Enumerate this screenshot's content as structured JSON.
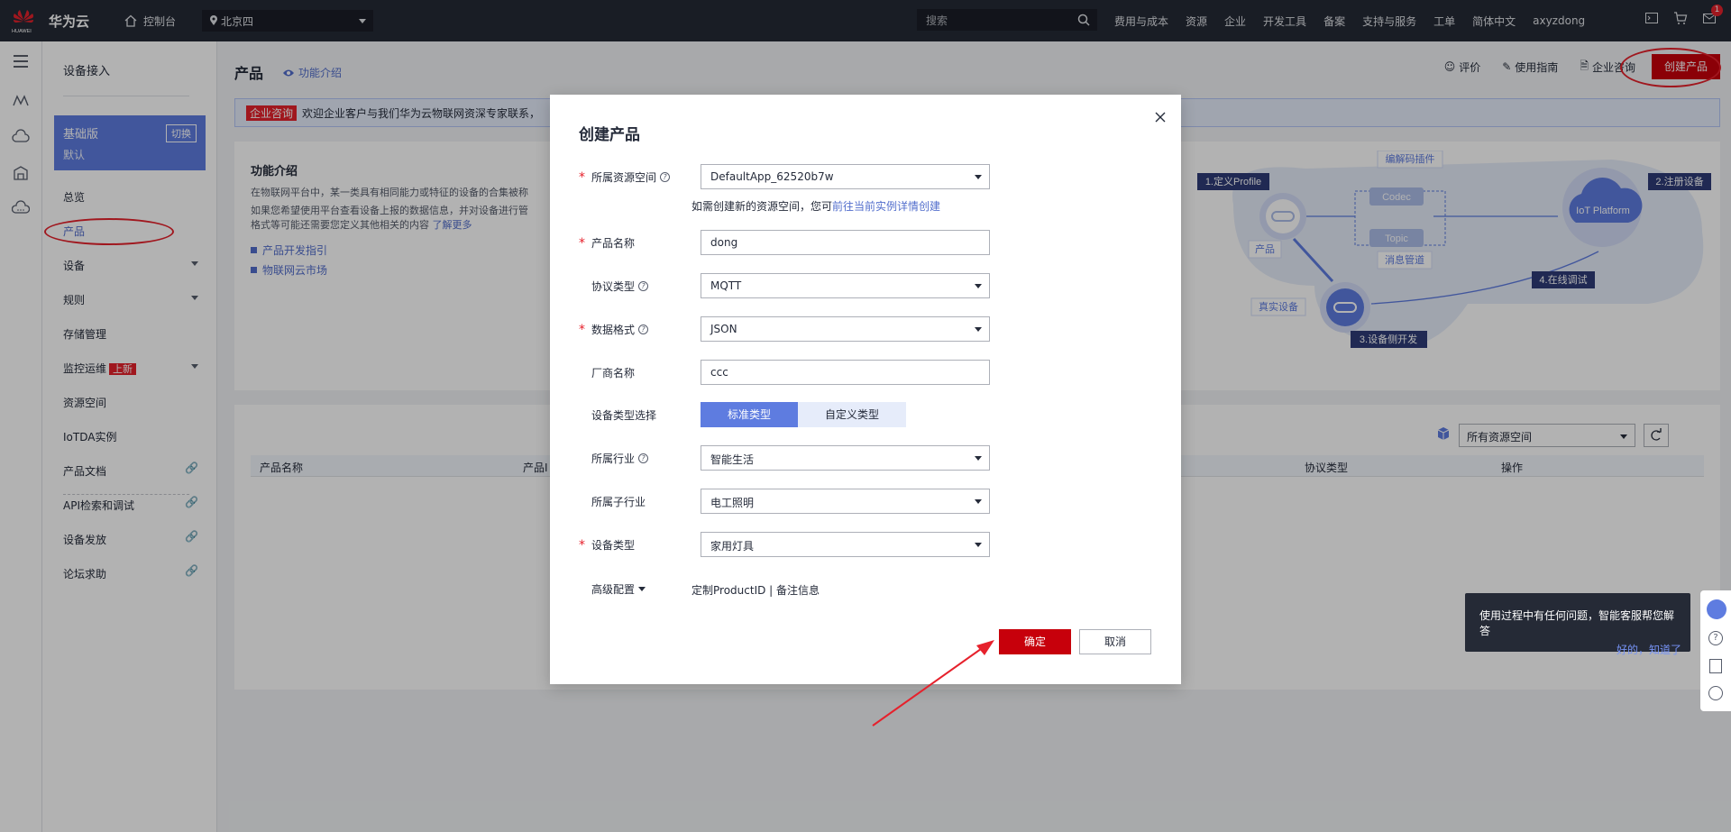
{
  "topbar": {
    "logo_text": "华为云",
    "logo_sub": "HUAWEI",
    "console": "控制台",
    "region": "北京四",
    "search_placeholder": "搜索",
    "nav": [
      "费用与成本",
      "资源",
      "企业",
      "开发工具",
      "备案",
      "支持与服务",
      "工单",
      "简体中文",
      "axyzdong"
    ],
    "mail_badge": "1"
  },
  "sidebar": {
    "title": "设备接入",
    "edition_name": "基础版",
    "edition_default": "默认",
    "edition_switch": "切换",
    "items": [
      {
        "label": "总览"
      },
      {
        "label": "产品"
      },
      {
        "label": "设备"
      },
      {
        "label": "规则"
      },
      {
        "label": "存储管理"
      },
      {
        "label": "监控运维",
        "badge": "上新"
      },
      {
        "label": "资源空间"
      },
      {
        "label": "IoTDA实例"
      },
      {
        "label": "产品文档"
      },
      {
        "label": "API检索和调试"
      },
      {
        "label": "设备发放"
      },
      {
        "label": "论坛求助"
      }
    ]
  },
  "main": {
    "title": "产品",
    "func_link": "功能介绍",
    "actions": {
      "rate": "评价",
      "guide": "使用指南",
      "consult": "企业咨询",
      "create": "创建产品"
    },
    "notice_tag": "企业咨询",
    "notice_text": "欢迎企业客户与我们华为云物联网资深专家联系，",
    "intro": {
      "title": "功能介绍",
      "p1": "在物联网平台中，某一类具有相同能力或特征的设备的合集被称",
      "p2": "如果您希望使用平台查看设备上报的数据信息，并对设备进行管",
      "p3": "格式等可能还需要您定义其他相关的内容",
      "more": "了解更多",
      "link1": "产品开发指引",
      "link2": "物联网云市场"
    },
    "diagram": {
      "step1": "1.定义Profile",
      "step2": "2.注册设备",
      "step3": "3.设备侧开发",
      "step4": "4.在线调试",
      "codec_plugin": "编解码插件",
      "codec": "Codec",
      "topic": "Topic",
      "msg_channel": "消息管道",
      "product": "产品",
      "real_device": "真实设备",
      "platform": "IoT Platform"
    },
    "table": {
      "space_select": "所有资源空间",
      "headers": [
        "产品名称",
        "产品I",
        "协议类型",
        "操作"
      ]
    }
  },
  "dialog": {
    "title": "创建产品",
    "fields": {
      "resource_space": {
        "label": "所属资源空间",
        "value": "DefaultApp_62520b7w"
      },
      "hint_pre": "如需创建新的资源空间，您可",
      "hint_link": "前往当前实例详情创建",
      "product_name": {
        "label": "产品名称",
        "value": "dong"
      },
      "protocol": {
        "label": "协议类型",
        "value": "MQTT"
      },
      "data_format": {
        "label": "数据格式",
        "value": "JSON"
      },
      "vendor": {
        "label": "厂商名称",
        "value": "ccc"
      },
      "device_type_select": {
        "label": "设备类型选择",
        "opt1": "标准类型",
        "opt2": "自定义类型"
      },
      "industry": {
        "label": "所属行业",
        "value": "智能生活"
      },
      "sub_industry": {
        "label": "所属子行业",
        "value": "电工照明"
      },
      "device_type": {
        "label": "设备类型",
        "value": "家用灯具"
      }
    },
    "advanced": "高级配置",
    "advanced_text": "定制ProductID | 备注信息",
    "ok": "确定",
    "cancel": "取消"
  },
  "assistant_tip": {
    "text": "使用过程中有任何问题，智能客服帮您解答",
    "ok": "好的，",
    "know": "知道了"
  }
}
